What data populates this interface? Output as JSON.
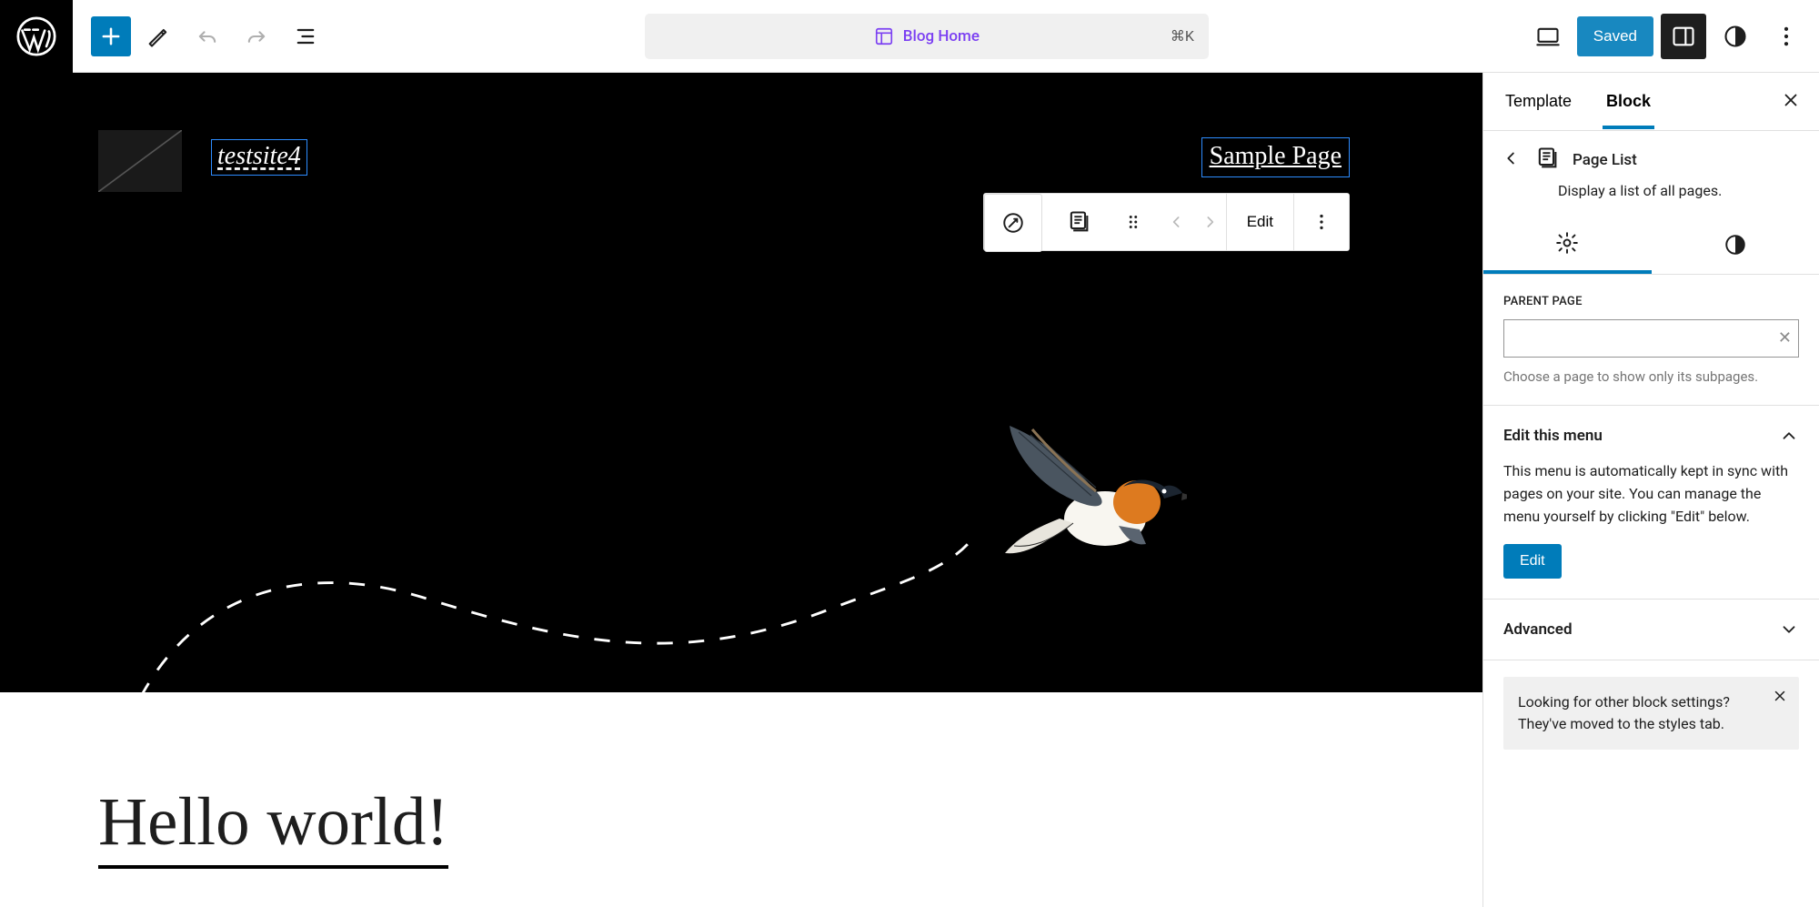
{
  "topbar": {
    "doc_title": "Blog Home",
    "doc_kbd": "⌘K",
    "saved": "Saved"
  },
  "hero": {
    "site_title": "testsite4",
    "nav_link": "Sample Page"
  },
  "block_toolbar": {
    "edit": "Edit"
  },
  "post": {
    "title": "Hello world!"
  },
  "inspector": {
    "tab_template": "Template",
    "tab_block": "Block",
    "block_name": "Page List",
    "block_desc": "Display a list of all pages.",
    "parent_label": "Parent Page",
    "parent_hint": "Choose a page to show only its subpages.",
    "edit_menu_title": "Edit this menu",
    "edit_menu_body": "This menu is automatically kept in sync with pages on your site. You can manage the menu yourself by clicking \"Edit\" below.",
    "edit_menu_btn": "Edit",
    "advanced": "Advanced",
    "notice": "Looking for other block settings? They've moved to the styles tab."
  }
}
